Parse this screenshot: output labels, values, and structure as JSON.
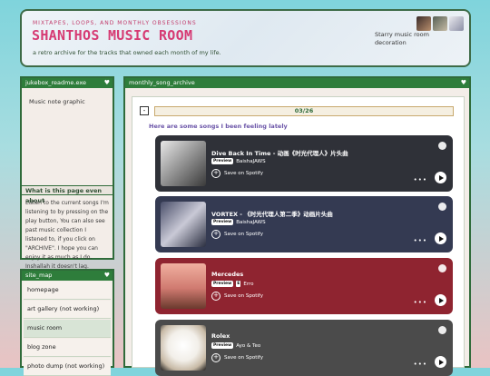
{
  "header": {
    "tagline": "MIXTAPES, LOOPS, AND MONTHLY OBSESSIONS",
    "title": "SHANTHOS MUSIC ROOM",
    "subtitle": "a retro archive for the tracks that owned each month of my life.",
    "decoration_alt": "Starry music room decoration"
  },
  "jukebox": {
    "bar_title": "jukebox_readme.exe",
    "image_alt": "Music note graphic",
    "about_title": "What is this page even about",
    "about_text": "Listen to the current songs I'm listening to by pressing on the play button, You can also see past music collection I listened to, if you click on \"ARCHIVE\". I hope you can enjoy it as much as I do. Inshallah it doesn't lag."
  },
  "site_map": {
    "bar_title": "site_map",
    "items": [
      {
        "label": "homepage"
      },
      {
        "label": "art gallery (not working)"
      },
      {
        "label": "music room"
      },
      {
        "label": "blog zone"
      },
      {
        "label": "photo dump (not working)"
      }
    ]
  },
  "main": {
    "bar_title": "monthly_song_archive",
    "toggle_label": "-",
    "month": "03/26",
    "intro": "Here are some songs I been feeling lately",
    "tracks": [
      {
        "title": "Dive Back In Time - 动画《时光代理人》片头曲",
        "badge": "Preview",
        "artist": "BaishaJAWS",
        "save": "Save on Spotify",
        "color": "#2f3138"
      },
      {
        "title": "VORTEX - 《时光代理人第二季》动画片头曲",
        "badge": "Preview",
        "artist": "BaishaJAWS",
        "save": "Save on Spotify",
        "color": "#343a52"
      },
      {
        "title": "Mercedes",
        "badge": "Preview",
        "explicit": "E",
        "artist": "Erro",
        "save": "Save on Spotify",
        "color": "#8f2430"
      },
      {
        "title": "Rolex",
        "badge": "Preview",
        "artist": "Ayo & Teo",
        "save": "Save on Spotify",
        "color": "#4b4b4b"
      }
    ]
  }
}
